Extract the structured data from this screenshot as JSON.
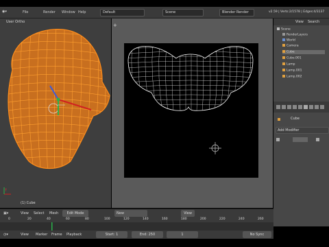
{
  "topbar": {
    "menus": [
      "File",
      "Render",
      "Window",
      "Help"
    ],
    "layout": "Default",
    "scene": "Scene",
    "render_engine": "Blender Render",
    "stats": "v2.59 | Verts:2/1578 | Edges:4/3137"
  },
  "viewport3d": {
    "label": "User Ortho",
    "object_label": "(1) Cube",
    "header_items": [
      "View",
      "Select",
      "Mesh"
    ],
    "mode": "Edit Mode",
    "colors": {
      "mesh": "#ff8c1a",
      "bg": "#3e3e3e"
    }
  },
  "uv_editor": {
    "header_items": [
      "View",
      "Select",
      "Image",
      "UVs"
    ],
    "image_dropdown": "New",
    "view_dropdown": "View",
    "colors": {
      "wire": "#ffffff",
      "image_bg": "#000000"
    }
  },
  "outliner": {
    "header": [
      "View",
      "Search"
    ],
    "items": [
      {
        "label": "Scene",
        "icon": "scene-icon"
      },
      {
        "label": "RenderLayers",
        "icon": "renderlayers-icon"
      },
      {
        "label": "World",
        "icon": "world-icon"
      },
      {
        "label": "Camera",
        "icon": "camera-icon"
      },
      {
        "label": "Cube",
        "icon": "mesh-icon"
      },
      {
        "label": "Cube.001",
        "icon": "mesh-icon"
      },
      {
        "label": "Lamp",
        "icon": "lamp-icon"
      },
      {
        "label": "Lamp.001",
        "icon": "lamp-icon"
      },
      {
        "label": "Lamp.002",
        "icon": "lamp-icon"
      }
    ]
  },
  "properties": {
    "object_name": "Cube",
    "add_modifier": "Add Modifier"
  },
  "timeline": {
    "header_items": [
      "View",
      "Marker",
      "Frame",
      "Playback"
    ],
    "start": "Start: 1",
    "end": "End: 250",
    "current": "1",
    "sync": "No Sync",
    "ticks": [
      "0",
      "20",
      "40",
      "60",
      "80",
      "100",
      "120",
      "140",
      "160",
      "180",
      "200",
      "220",
      "240",
      "260"
    ]
  }
}
